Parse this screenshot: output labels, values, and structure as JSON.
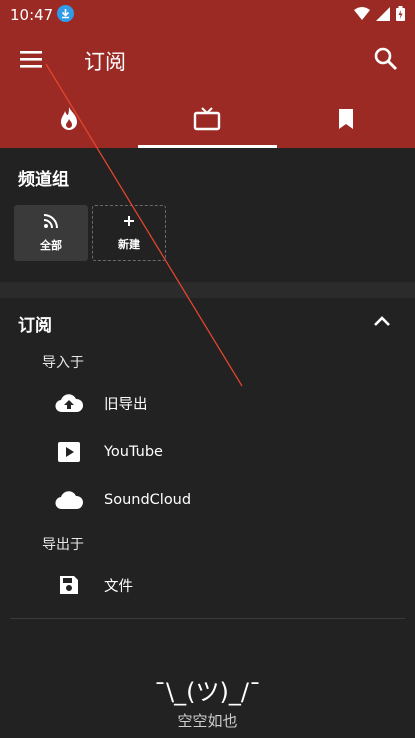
{
  "status_bar": {
    "time": "10:47"
  },
  "toolbar": {
    "title": "订阅"
  },
  "tabs": [
    {
      "icon": "fire-icon",
      "active": false
    },
    {
      "icon": "tv-icon",
      "active": true
    },
    {
      "icon": "bookmark-icon",
      "active": false
    }
  ],
  "channel_groups": {
    "title": "频道组",
    "all_label": "全部",
    "new_label": "新建"
  },
  "subscriptions": {
    "title": "订阅",
    "import_from": "导入于",
    "import_items": [
      {
        "label": "旧导出",
        "icon": "cloud-upload-icon"
      },
      {
        "label": "YouTube",
        "icon": "youtube-play-icon"
      },
      {
        "label": "SoundCloud",
        "icon": "cloud-icon"
      }
    ],
    "export_to": "导出于",
    "export_items": [
      {
        "label": "文件",
        "icon": "save-icon"
      }
    ]
  },
  "empty_state": {
    "kaomoji": "¯\\_(ツ)_/¯",
    "text": "空空如也"
  },
  "colors": {
    "appbar": "#9b2a25",
    "background": "#222222",
    "accent_line": "#e0452e"
  }
}
